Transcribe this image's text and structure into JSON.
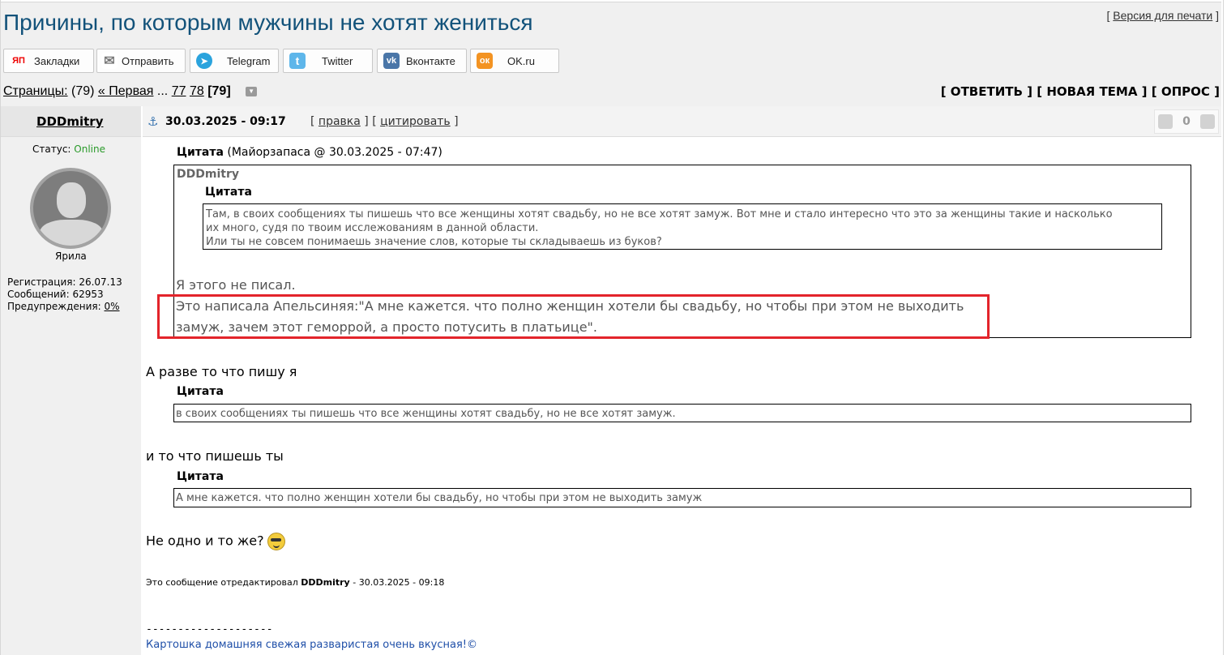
{
  "page": {
    "title": "Причины, по которым мужчины не хотят жениться",
    "print_link": "Версия для печати"
  },
  "share_buttons": [
    {
      "label": "Закладки",
      "icon": "yandex-bookmarks-icon",
      "glyph": "ЯП",
      "color": "#ffffff"
    },
    {
      "label": "Отправить",
      "icon": "envelope-icon",
      "glyph": "✉",
      "color": "#ffffff"
    },
    {
      "label": "Telegram",
      "icon": "telegram-icon",
      "glyph": "➤",
      "color": "#2aa3dd"
    },
    {
      "label": "Twitter",
      "icon": "twitter-icon",
      "glyph": "t",
      "color": "#5eb6ea"
    },
    {
      "label": "Вконтакте",
      "icon": "vk-icon",
      "glyph": "vk",
      "color": "#4a76a8"
    },
    {
      "label": "OK.ru",
      "icon": "odnoklassniki-icon",
      "glyph": "ок",
      "color": "#f39322"
    }
  ],
  "pagination": {
    "label": "Страницы:",
    "count": "(79)",
    "first": "« Первая",
    "ellipsis": "...",
    "p1": "77",
    "p2": "78",
    "current": "[79]"
  },
  "actions": {
    "reply": "[ ОТВЕТИТЬ ]",
    "new_topic": "[ НОВАЯ ТЕМА ]",
    "poll": "[ ОПРОС ]"
  },
  "post": {
    "author": "DDDmitry",
    "date": "30.03.2025 - 09:17",
    "edit": "правка",
    "quote": "цитировать",
    "rating": "0",
    "status_label": "Статус:",
    "status_value": "Online",
    "avatar_caption": "Ярила",
    "registration": "Регистрация: 26.07.13",
    "messages": "Сообщений: 62953",
    "warnings_label": "Предупреждения:",
    "warnings_value": "0%"
  },
  "quote1": {
    "label": "Цитата",
    "meta": "(Майорзапаса @ 30.03.2025 - 07:47)",
    "inner_author": "DDDmitry",
    "inner_label": "Цитата",
    "inner_line1": "Там, в своих сообщениях ты пишешь что все женщины хотят свадьбу, но не все хотят замуж. Вот мне и стало интересно что это за женщины такие и насколько",
    "inner_line2": "их много, судя по твоим исслежованиям в данной области.",
    "inner_line3": "Или ты не совсем понимаешь значение слов, которые ты складываешь из буков?",
    "reply1": "Я этого не писал.",
    "reply2": "Это написала Апельсиняя:\"А мне кажется. что полно женщин хотели бы свадьбу, но чтобы при этом не выходить",
    "reply3": "замуж, зачем этот геморрой, а просто потусить в платьице\"."
  },
  "text1": "А разве то что пишу я",
  "quote2": {
    "label": "Цитата",
    "text": "в своих сообщениях ты пишешь что все женщины хотят свадьбу, но не все хотят замуж."
  },
  "text2": "и то что пишешь ты",
  "quote3": {
    "label": "Цитата",
    "text": "А мне кажется. что полно женщин хотели бы свадьбу, но чтобы при этом не выходить замуж"
  },
  "text3": "Не одно и то же?",
  "edited": {
    "prefix": "Это сообщение отредактировал",
    "author": "DDDmitry",
    "suffix": "- 30.03.2025 - 09:18"
  },
  "signature": {
    "divider": "--------------------",
    "text": "Картошка домашняя свежая разваристая очень вкусная!©"
  }
}
